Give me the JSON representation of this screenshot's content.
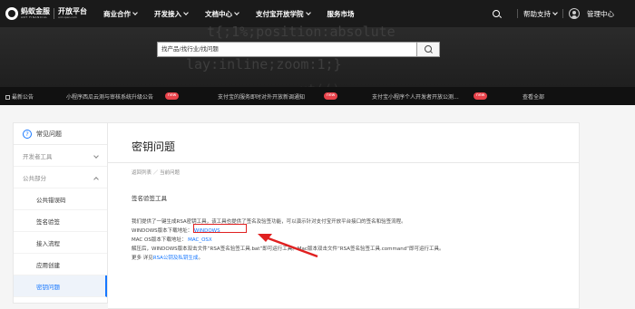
{
  "nav": {
    "logo_cn": "蚂蚁金服",
    "logo_en": "ANT FINANCIAL",
    "platform_cn": "开放平台",
    "platform_en": "ant.open.com",
    "menu": [
      "商业合作",
      "开发接入",
      "文档中心",
      "支付宝开放学院",
      "服务市场"
    ],
    "help": "帮助支持",
    "admin": "管理中心"
  },
  "hero": {
    "search_placeholder": "找产品/找行业/找问题",
    "code_lines": [
      "t{;1%;position:absolute",
      "lay:inline;zoom:1;}",
      "ut(()"
    ]
  },
  "ticker": {
    "items": [
      "最新公告",
      "小程序西瓜云测与审核系统升级公告",
      "支付宝的服务即时对外开放新调通知",
      "支付宝小程序个人开发者开放公测...",
      "查看全部"
    ],
    "badge": "new"
  },
  "sidebar": {
    "header": "常见问题",
    "group1": "开发者工具",
    "group2": "公共部分",
    "items": [
      "公共错误码",
      "签名验签",
      "接入流程",
      "应用创建",
      "密钥问题"
    ]
  },
  "content": {
    "title": "密钥问题",
    "breadcrumb": "返回列表 ／ 当前问题",
    "section": "签名验签工具",
    "p1": "我们提供了一键生成RSA密钥工具，该工具也提供了签名及验签功能，可以演示针对支付宝开放平台接口的签名和验签流程。",
    "p2_label": "WINDOWS版本下载地址：",
    "p2_link": "WINDOWS",
    "p3_label": "MAC OS版本下载地址：",
    "p3_link": "MAC_OSX",
    "p4": "解压后，WINDOWS版本双击文件“RSA签名验签工具.bat”即可运行工具。Mac版本双击文件“RSA签名验签工具.command”即可运行工具。",
    "p5_prefix": "更多 详见",
    "p5_link": "RSA公钥及私钥生成",
    "p5_suffix": "。"
  }
}
